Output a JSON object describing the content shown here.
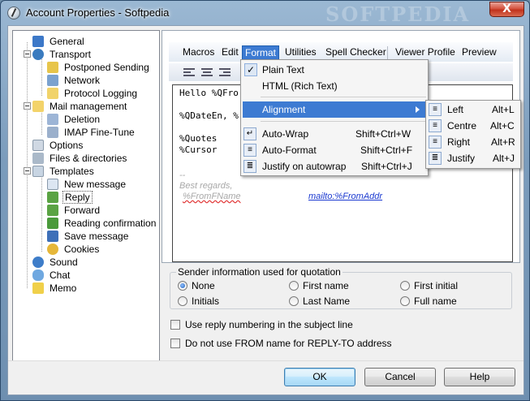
{
  "window": {
    "title": "Account Properties - Softpedia",
    "close_label": "X",
    "watermark": "SOFTPEDIA"
  },
  "tree": {
    "items": [
      {
        "label": "General",
        "icon": "general-icon",
        "color": "#3c78c8"
      },
      {
        "label": "Transport",
        "icon": "transport-icon",
        "color": "#3a7bbf"
      },
      {
        "label": "Postponed Sending",
        "icon": "postponed-icon",
        "color": "#e7c54b"
      },
      {
        "label": "Network",
        "icon": "network-icon",
        "color": "#7ba2cf"
      },
      {
        "label": "Protocol Logging",
        "icon": "log-icon",
        "color": "#f1d36a"
      },
      {
        "label": "Mail management",
        "icon": "mail-management-icon",
        "color": "#f3d36a"
      },
      {
        "label": "Deletion",
        "icon": "deletion-icon",
        "color": "#9db5d6"
      },
      {
        "label": "IMAP Fine-Tune",
        "icon": "imap-icon",
        "color": "#9bb0cc"
      },
      {
        "label": "Options",
        "icon": "options-icon",
        "color": "#cfd8e3"
      },
      {
        "label": "Files & directories",
        "icon": "files-icon",
        "color": "#aab9c9"
      },
      {
        "label": "Templates",
        "icon": "templates-icon",
        "color": "#c8d5e3"
      },
      {
        "label": "New message",
        "icon": "new-message-icon",
        "color": "#dce6f2"
      },
      {
        "label": "Reply",
        "icon": "reply-icon",
        "color": "#5aa343"
      },
      {
        "label": "Forward",
        "icon": "forward-icon",
        "color": "#5aa343"
      },
      {
        "label": "Reading confirmation",
        "icon": "confirmation-icon",
        "color": "#4a9a3b"
      },
      {
        "label": "Save message",
        "icon": "save-icon",
        "color": "#3d6fb8"
      },
      {
        "label": "Cookies",
        "icon": "cookies-icon",
        "color": "#e6b73a"
      },
      {
        "label": "Sound",
        "icon": "sound-icon",
        "color": "#3e7dc9"
      },
      {
        "label": "Chat",
        "icon": "chat-icon",
        "color": "#6fa8e0"
      },
      {
        "label": "Memo",
        "icon": "memo-icon",
        "color": "#f0d04a"
      }
    ]
  },
  "menubar": [
    "Macros",
    "Edit",
    "Format",
    "Utilities",
    "Spell Checker",
    "Viewer Profile",
    "Preview"
  ],
  "editor": {
    "lines": [
      "Hello %QFro",
      "",
      "%QDateEn, %",
      "",
      "%Quotes",
      "%Cursor"
    ],
    "sig_dash": "--",
    "sig_regards": "Best regards,",
    "sig_name": "%FromFName",
    "sig_mailto": "mailto:%FromAddr"
  },
  "format_menu": {
    "items": [
      {
        "label": "Plain Text",
        "checked": true,
        "shortcut": ""
      },
      {
        "label": "HTML (Rich Text)",
        "checked": false,
        "shortcut": ""
      },
      {
        "label": "Alignment",
        "submenu": true
      },
      {
        "label": "Auto-Wrap",
        "shortcut": "Shift+Ctrl+W",
        "icon": "auto-wrap-icon"
      },
      {
        "label": "Auto-Format",
        "shortcut": "Shift+Ctrl+F",
        "icon": "auto-format-icon"
      },
      {
        "label": "Justify on autowrap",
        "shortcut": "Shift+Ctrl+J",
        "icon": "justify-autowrap-icon"
      }
    ]
  },
  "alignment_menu": {
    "items": [
      {
        "label": "Left",
        "shortcut": "Alt+L",
        "icon": "align-left-icon"
      },
      {
        "label": "Centre",
        "shortcut": "Alt+C",
        "icon": "align-center-icon"
      },
      {
        "label": "Right",
        "shortcut": "Alt+R",
        "icon": "align-right-icon"
      },
      {
        "label": "Justify",
        "shortcut": "Alt+J",
        "icon": "align-justify-icon"
      }
    ]
  },
  "sender_group": {
    "title": "Sender information used for quotation",
    "options": [
      {
        "label": "None",
        "selected": true
      },
      {
        "label": "First name",
        "selected": false
      },
      {
        "label": "First initial",
        "selected": false
      },
      {
        "label": "Initials",
        "selected": false
      },
      {
        "label": "Last Name",
        "selected": false
      },
      {
        "label": "Full name",
        "selected": false
      }
    ]
  },
  "checkboxes": [
    {
      "label": "Use reply numbering in the subject line",
      "checked": false
    },
    {
      "label": "Do not use FROM name for REPLY-TO address",
      "checked": false
    }
  ],
  "buttons": {
    "ok": "OK",
    "cancel": "Cancel",
    "help": "Help"
  },
  "colors": {
    "accent": "#3d7bd2",
    "titlebar": "#7b9cbc",
    "close": "#c0321c"
  }
}
